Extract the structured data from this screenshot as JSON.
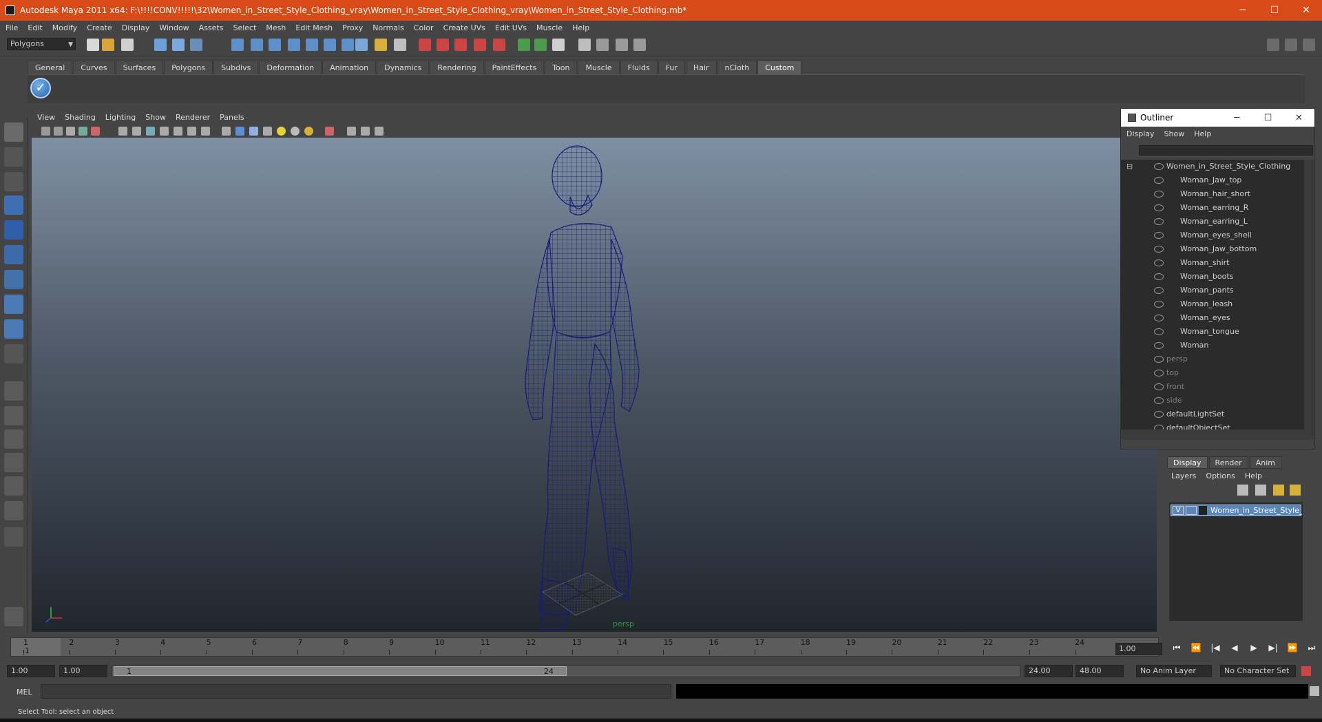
{
  "window": {
    "title": "Autodesk Maya 2011 x64: F:\\!!!!CONV!!!!!\\32\\Women_in_Street_Style_Clothing_vray\\Women_in_Street_Style_Clothing_vray\\Women_in_Street_Style_Clothing.mb*",
    "minimize": "─",
    "maximize": "☐",
    "close": "✕"
  },
  "menubar": [
    "File",
    "Edit",
    "Modify",
    "Create",
    "Display",
    "Window",
    "Assets",
    "Select",
    "Mesh",
    "Edit Mesh",
    "Proxy",
    "Normals",
    "Color",
    "Create UVs",
    "Edit UVs",
    "Muscle",
    "Help"
  ],
  "statusline": {
    "mode": "Polygons"
  },
  "shelf": {
    "tabs": [
      "General",
      "Curves",
      "Surfaces",
      "Polygons",
      "Subdivs",
      "Deformation",
      "Animation",
      "Dynamics",
      "Rendering",
      "PaintEffects",
      "Toon",
      "Muscle",
      "Fluids",
      "Fur",
      "Hair",
      "nCloth",
      "Custom"
    ],
    "active_tab": "Custom",
    "check_glyph": "✓"
  },
  "viewport": {
    "menu": [
      "View",
      "Shading",
      "Lighting",
      "Show",
      "Renderer",
      "Panels"
    ],
    "camera_label": "persp",
    "wire_color": "#141c7a"
  },
  "outliner": {
    "title": "Outliner",
    "menu": [
      "Display",
      "Show",
      "Help"
    ],
    "root": "Women_in_Street_Style_Clothing",
    "children": [
      "Woman_Jaw_top",
      "Woman_hair_short",
      "Woman_earring_R",
      "Woman_earring_L",
      "Woman_eyes_shell",
      "Woman_Jaw_bottom",
      "Woman_shirt",
      "Woman_boots",
      "Woman_pants",
      "Woman_leash",
      "Woman_eyes",
      "Woman_tongue",
      "Woman"
    ],
    "cameras": [
      "persp",
      "top",
      "front",
      "side"
    ],
    "sets": [
      "defaultLightSet",
      "defaultObjectSet"
    ]
  },
  "layer_editor": {
    "tabs": [
      "Display",
      "Render",
      "Anim"
    ],
    "active_tab": "Display",
    "menu": [
      "Layers",
      "Options",
      "Help"
    ],
    "layer_visible_flag": "V",
    "layer_name": "Women_in_Street_Style_Clothing_layer"
  },
  "time_slider": {
    "ticks": [
      "1",
      "2",
      "3",
      "4",
      "5",
      "6",
      "7",
      "8",
      "9",
      "10",
      "11",
      "12",
      "13",
      "14",
      "15",
      "16",
      "17",
      "18",
      "19",
      "20",
      "21",
      "22",
      "23",
      "24"
    ],
    "current_frame": "1",
    "current_time": "1.00",
    "playback_glyphs": [
      "⏮",
      "⏪",
      "|◀",
      "◀",
      "▶",
      "▶|",
      "⏩",
      "⏭"
    ]
  },
  "range_slider": {
    "start_time": "1.00",
    "start_range": "1.00",
    "handle_start": "1",
    "handle_end": "24",
    "end_range": "24.00",
    "end_time": "48.00",
    "anim_layer": "No Anim Layer",
    "character_set": "No Character Set"
  },
  "command_line": {
    "label": "MEL"
  },
  "help_line": {
    "text": "Select Tool: select an object"
  }
}
